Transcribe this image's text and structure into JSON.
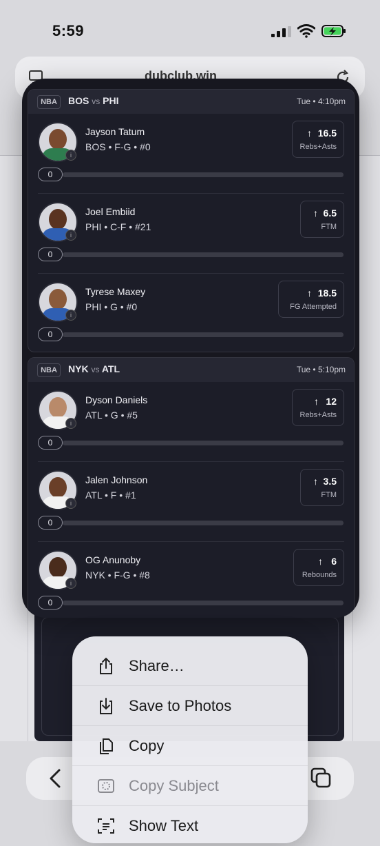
{
  "status": {
    "time": "5:59"
  },
  "browser": {
    "url": "dubclub.win"
  },
  "games": [
    {
      "league": "NBA",
      "home": "BOS",
      "vs": "vs",
      "away": "PHI",
      "time": "Tue • 4:10pm",
      "players": [
        {
          "name": "Jayson Tatum",
          "meta": "BOS • F-G • #0",
          "line": "16.5",
          "stat": "Rebs+Asts",
          "progress": "0",
          "progress_fraction": 0,
          "jersey": "#2e7d4f"
        },
        {
          "name": "Joel Embiid",
          "meta": "PHI • C-F • #21",
          "line": "6.5",
          "stat": "FTM",
          "progress": "0",
          "progress_fraction": 0,
          "jersey": "#2f5fb3"
        },
        {
          "name": "Tyrese Maxey",
          "meta": "PHI • G • #0",
          "line": "18.5",
          "stat": "FG Attempted",
          "progress": "0",
          "progress_fraction": 0,
          "jersey": "#2f5fb3"
        }
      ]
    },
    {
      "league": "NBA",
      "home": "NYK",
      "vs": "vs",
      "away": "ATL",
      "time": "Tue • 5:10pm",
      "players": [
        {
          "name": "Dyson Daniels",
          "meta": "ATL • G • #5",
          "line": "12",
          "stat": "Rebs+Asts",
          "progress": "0",
          "progress_fraction": 0,
          "jersey": "#ffffff"
        },
        {
          "name": "Jalen Johnson",
          "meta": "ATL • F • #1",
          "line": "3.5",
          "stat": "FTM",
          "progress": "0",
          "progress_fraction": 0,
          "jersey": "#ffffff"
        },
        {
          "name": "OG Anunoby",
          "meta": "NYK • F-G • #8",
          "line": "6",
          "stat": "Rebounds",
          "progress": "0",
          "progress_fraction": 0,
          "jersey": "#ffffff"
        }
      ]
    }
  ],
  "context_menu": {
    "items": [
      {
        "label": "Share…",
        "icon": "share-icon",
        "enabled": true
      },
      {
        "label": "Save to Photos",
        "icon": "save-photos-icon",
        "enabled": true
      },
      {
        "label": "Copy",
        "icon": "copy-icon",
        "enabled": true
      },
      {
        "label": "Copy Subject",
        "icon": "copy-subject-icon",
        "enabled": false
      },
      {
        "label": "Show Text",
        "icon": "show-text-icon",
        "enabled": true
      }
    ]
  },
  "colors": {
    "card_bg": "#17171f",
    "header_bg": "#262733",
    "accent": "#ffffff"
  }
}
